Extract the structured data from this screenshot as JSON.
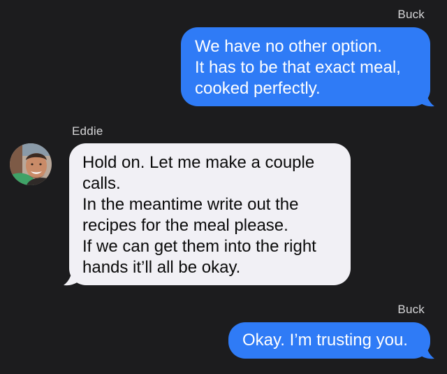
{
  "messages": [
    {
      "direction": "outgoing",
      "sender": "Buck",
      "text": "We have no other option.\nIt has to be that exact meal,\ncooked perfectly."
    },
    {
      "direction": "incoming",
      "sender": "Eddie",
      "avatar": "contact-photo",
      "text": "Hold on. Let me make a couple\ncalls.\nIn the meantime write out the\nrecipes for the meal please.\nIf we can get them into the right\nhands it’ll all be okay."
    },
    {
      "direction": "outgoing",
      "sender": "Buck",
      "text": "Okay. I’m trusting you."
    }
  ],
  "colors": {
    "background": "#1c1c1e",
    "outgoing_bubble": "#2f7bf6",
    "incoming_bubble": "#f1f0f5",
    "sender_label": "#d6d6d8"
  }
}
